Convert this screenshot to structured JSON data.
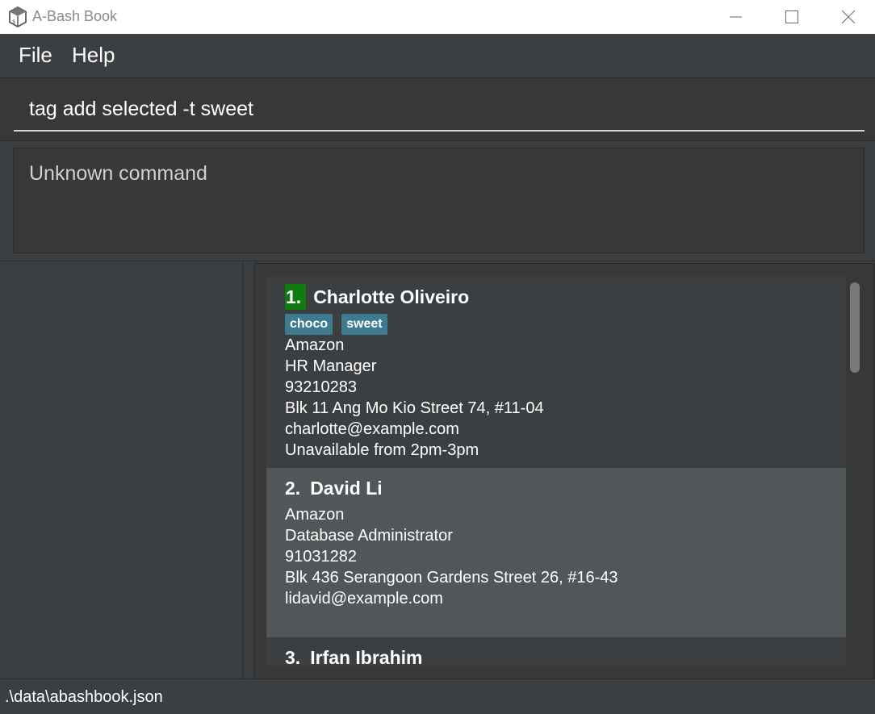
{
  "window": {
    "title": "A-Bash Book",
    "icon": "app-logo-icon"
  },
  "menu": {
    "file_label": "File",
    "help_label": "Help"
  },
  "command": {
    "value": "tag add selected -t sweet"
  },
  "result": {
    "message": "Unknown command"
  },
  "contacts": [
    {
      "index": "1.",
      "name": "Charlotte Oliveiro",
      "tags": [
        "choco",
        "sweet"
      ],
      "company": "Amazon",
      "job": "HR Manager",
      "phone": "93210283",
      "address": "Blk 11 Ang Mo Kio Street 74, #11-04",
      "email": "charlotte@example.com",
      "remark": "Unavailable from 2pm-3pm",
      "selected": true
    },
    {
      "index": "2.",
      "name": "David Li",
      "tags": [],
      "company": "Amazon",
      "job": "Database Administrator",
      "phone": "91031282",
      "address": "Blk 436 Serangoon Gardens Street 26, #16-43",
      "email": "lidavid@example.com",
      "selected": false
    },
    {
      "index": "3.",
      "name": "Irfan Ibrahim",
      "selected": false
    }
  ],
  "status": {
    "file_path": ".\\data\\abashbook.json"
  },
  "colors": {
    "background": "#3c3f41",
    "selected_index": "#107c10",
    "tag": "#3e7b91",
    "card_alt": "#515658"
  }
}
